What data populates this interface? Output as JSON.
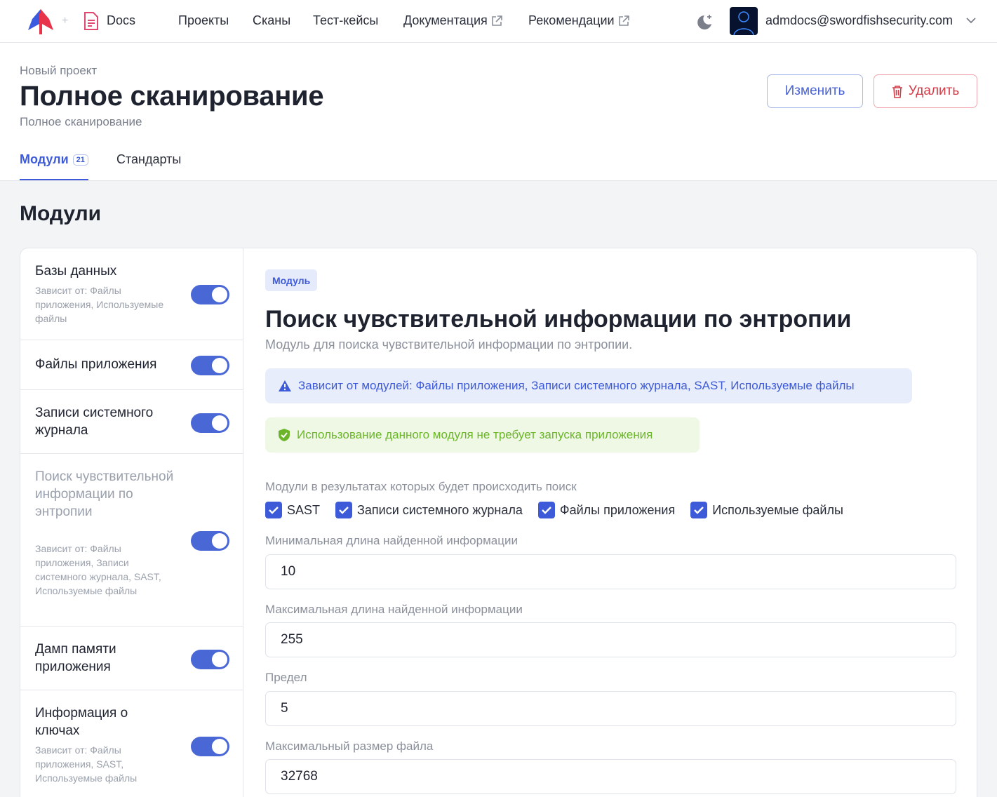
{
  "topbar": {
    "docs_label": "Docs",
    "nav": [
      {
        "label": "Проекты",
        "external": false
      },
      {
        "label": "Сканы",
        "external": false
      },
      {
        "label": "Тест-кейсы",
        "external": false
      },
      {
        "label": "Документация",
        "external": true
      },
      {
        "label": "Рекомендации",
        "external": true
      }
    ],
    "user_email": "admdocs@swordfishsecurity.com"
  },
  "header": {
    "breadcrumb": "Новый проект",
    "title": "Полное сканирование",
    "subtitle": "Полное сканирование",
    "edit_label": "Изменить",
    "delete_label": "Удалить",
    "tabs": [
      {
        "label": "Модули",
        "badge": "21",
        "active": true
      },
      {
        "label": "Стандарты",
        "active": false
      }
    ]
  },
  "section_title": "Модули",
  "modules": [
    {
      "title": "Базы данных",
      "dep": "Зависит от: Файлы приложения, Используемые файлы",
      "enabled": true
    },
    {
      "title": "Файлы приложения",
      "dep": "",
      "enabled": true
    },
    {
      "title": "Записи системного журнала",
      "dep": "",
      "enabled": true
    },
    {
      "title": "Поиск чувствительной информации по энтропии",
      "dep": "Зависит от: Файлы приложения, Записи системного журнала, SAST, Используемые файлы",
      "enabled": true
    },
    {
      "title": "Дамп памяти приложения",
      "dep": "",
      "enabled": true
    },
    {
      "title": "Информация о ключах",
      "dep": "Зависит от: Файлы приложения, SAST, Используемые файлы",
      "enabled": true
    }
  ],
  "detail": {
    "tag": "Модуль",
    "title": "Поиск чувствительной информации по энтропии",
    "description": "Модуль для поиска чувствительной информации по энтропии.",
    "depends_alert": "Зависит от модулей: Файлы приложения, Записи системного журнала, SAST, Используемые файлы",
    "no_launch_alert": "Использование данного модуля не требует запуска приложения",
    "search_modules_label": "Модули в результатах которых будет происходить поиск",
    "search_modules": [
      {
        "label": "SAST",
        "checked": true
      },
      {
        "label": "Записи системного журнала",
        "checked": true
      },
      {
        "label": "Файлы приложения",
        "checked": true
      },
      {
        "label": "Используемые файлы",
        "checked": true
      }
    ],
    "fields": [
      {
        "label": "Минимальная длина найденной информации",
        "value": "10"
      },
      {
        "label": "Максимальная длина найденной информации",
        "value": "255"
      },
      {
        "label": "Предел",
        "value": "5"
      },
      {
        "label": "Максимальный размер файла",
        "value": "32768"
      }
    ]
  },
  "colors": {
    "accent": "#3d5bd9",
    "danger": "#d23c48",
    "success": "#6cb52a",
    "toggle_on": "#4a67d6"
  }
}
